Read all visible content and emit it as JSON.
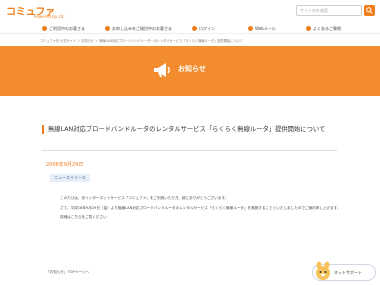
{
  "header": {
    "logo_main": "コミュファ",
    "logo_sub": "Powered by ctc",
    "search_placeholder": "サイト内を検索"
  },
  "nav": {
    "items": [
      {
        "label": "ご利用中のお客さま",
        "icon": "user-icon"
      },
      {
        "label": "お申し込みをご検討中のお客さま",
        "icon": "cart-icon"
      },
      {
        "label": "ログイン",
        "icon": "lock-icon"
      },
      {
        "label": "Webメール",
        "icon": "mail-icon"
      },
      {
        "label": "よくあるご質問",
        "icon": "question-icon"
      }
    ]
  },
  "breadcrumb": "コミュファ光 公式サイト ＞ お知らせ ＞ 無線LAN対応ブロードバンドルーターのレンタルサービス「らくらく無線ルータ」提供開始について",
  "banner": {
    "title": "お知らせ",
    "icon": "megaphone-icon"
  },
  "article": {
    "title": "無線LAN対応ブロードバンドルータのレンタルサービス「らくらく無線ルータ」提供開始について",
    "date": "2006年9月29日",
    "badge": "ニュースリリース",
    "paragraphs": [
      "このたびは、光インターネットサービス「コミュファ」をご利用いただき、誠にありがとうございます。",
      "さて、平成18年9月29日（金）より無線LAN対応ブロードバンドルータのレンタルサービス「らくらく無線ルータ」を実施することといたしましたのでご案内申し上げます。",
      "詳細はこちらをご覧ください"
    ]
  },
  "back_link": "「お知らせ」TOPページへ",
  "support": {
    "label": "ネットサポート",
    "icon": "mascot-icon"
  },
  "colors": {
    "accent": "#f07d1a",
    "banner": "#f28c2e"
  }
}
